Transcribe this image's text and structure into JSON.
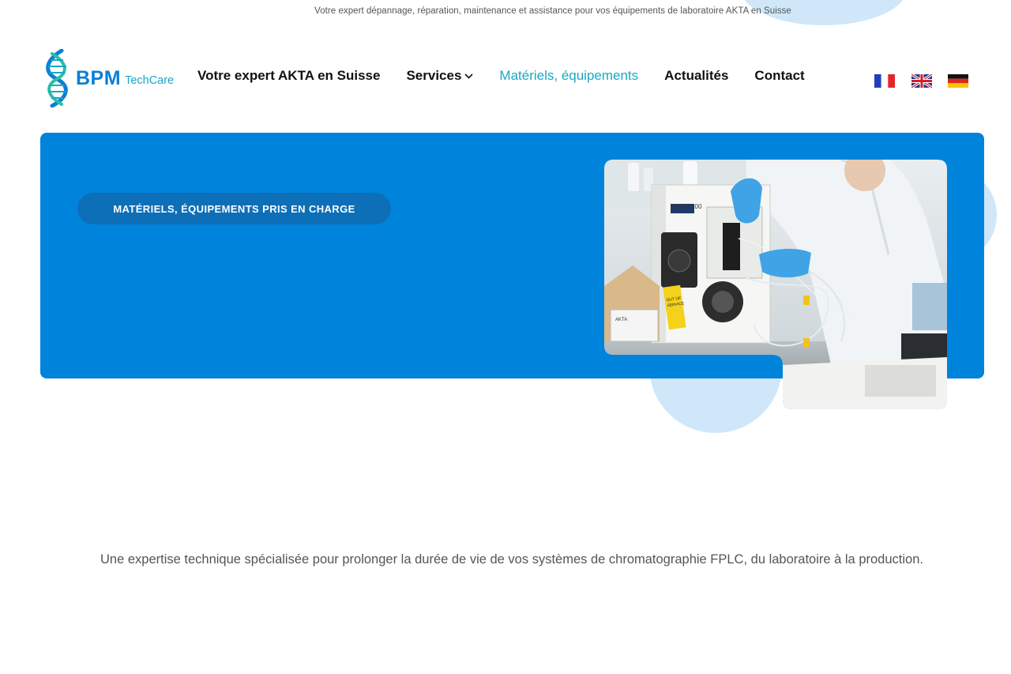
{
  "topbar": {
    "text": "Votre expert dépannage, réparation, maintenance et assistance pour vos équipements de laboratoire AKTA en Suisse"
  },
  "brand": {
    "name": "BPM",
    "suffix": "TechCare",
    "primary_color": "#0b7fd6",
    "accent_color": "#17a9c3",
    "logo_icon": "dna-helix-icon"
  },
  "nav": {
    "items": [
      {
        "label": "Votre expert AKTA en Suisse",
        "active": false
      },
      {
        "label": "Services",
        "active": false,
        "has_dropdown": true,
        "icon": "chevron-down-icon"
      },
      {
        "label": "Matériels, équipements",
        "active": true
      },
      {
        "label": "Actualités",
        "active": false
      },
      {
        "label": "Contact",
        "active": false
      }
    ]
  },
  "languages": [
    {
      "code": "fr",
      "icon": "flag-france-icon"
    },
    {
      "code": "en",
      "icon": "flag-uk-icon"
    },
    {
      "code": "de",
      "icon": "flag-germany-icon"
    }
  ],
  "hero": {
    "background_color": "#0083db",
    "badge": "MATÉRIELS, ÉQUIPEMENTS PRIS EN CHARGE",
    "badge_color": "#0d6fb8",
    "image": {
      "label": "AKTA 100",
      "tag_lines": [
        "OUT OF",
        "SERVICE"
      ],
      "box_label": "AKTA"
    }
  },
  "decor_color": "#cfe7f8",
  "tagline": "Une expertise technique spécialisée pour prolonger la durée de vie de vos systèmes de chromatographie FPLC, du laboratoire à la production."
}
